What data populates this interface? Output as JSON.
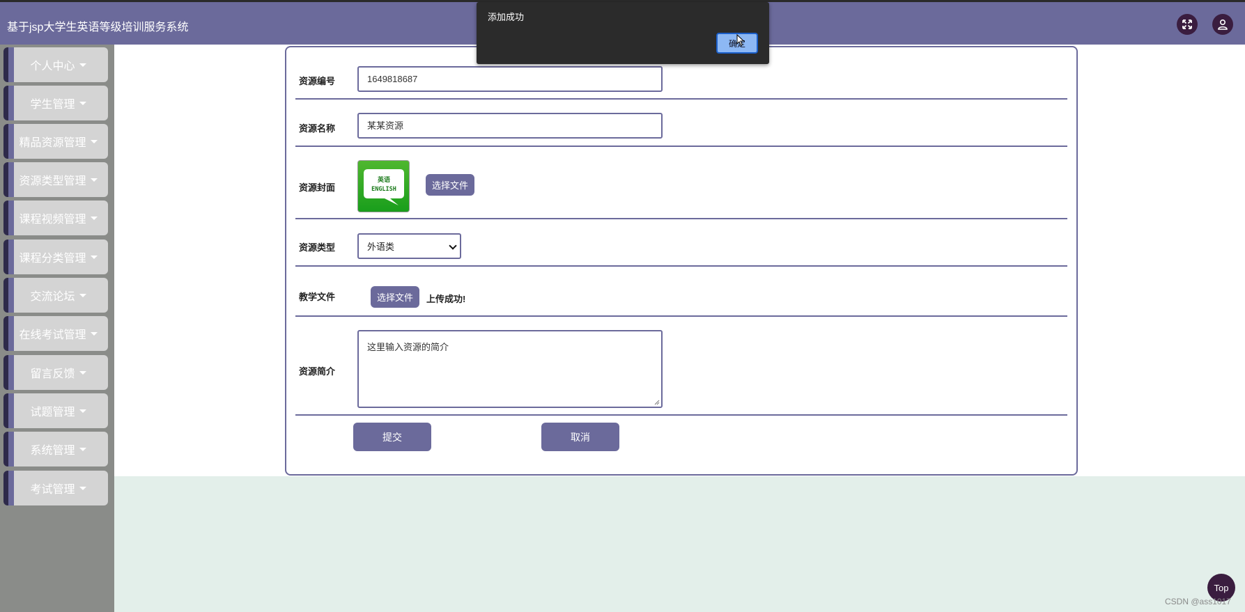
{
  "header": {
    "title": "基于jsp大学生英语等级培训服务系统",
    "fullscreen_icon": "fullscreen-icon",
    "user_icon": "user-icon"
  },
  "sidebar": {
    "items": [
      {
        "label": "个人中心"
      },
      {
        "label": "学生管理"
      },
      {
        "label": "精品资源管理"
      },
      {
        "label": "资源类型管理"
      },
      {
        "label": "课程视频管理"
      },
      {
        "label": "课程分类管理"
      },
      {
        "label": "交流论坛"
      },
      {
        "label": "在线考试管理"
      },
      {
        "label": "留言反馈"
      },
      {
        "label": "试题管理"
      },
      {
        "label": "系统管理"
      },
      {
        "label": "考试管理"
      }
    ]
  },
  "form": {
    "resource_no": {
      "label": "资源编号",
      "value": "1649818687"
    },
    "resource_name": {
      "label": "资源名称",
      "value": "某某资源"
    },
    "cover": {
      "label": "资源封面",
      "button": "选择文件",
      "image_text": "英语 ENGLISH"
    },
    "resource_type": {
      "label": "资源类型",
      "selected": "外语类"
    },
    "teaching_file": {
      "label": "教学文件",
      "button": "选择文件",
      "status": "上传成功!"
    },
    "intro": {
      "label": "资源简介",
      "placeholder": "这里输入资源的简介"
    },
    "submit": "提交",
    "cancel": "取消"
  },
  "dialog": {
    "message": "添加成功",
    "ok_button": "确定"
  },
  "back_to_top": "Top",
  "watermark": "CSDN @ass1017",
  "colors": {
    "accent": "#6b6a9b",
    "topbar": "#6b6a9b",
    "dark_icon_bg": "#3a1d3f",
    "content_bg": "#e3efea"
  }
}
